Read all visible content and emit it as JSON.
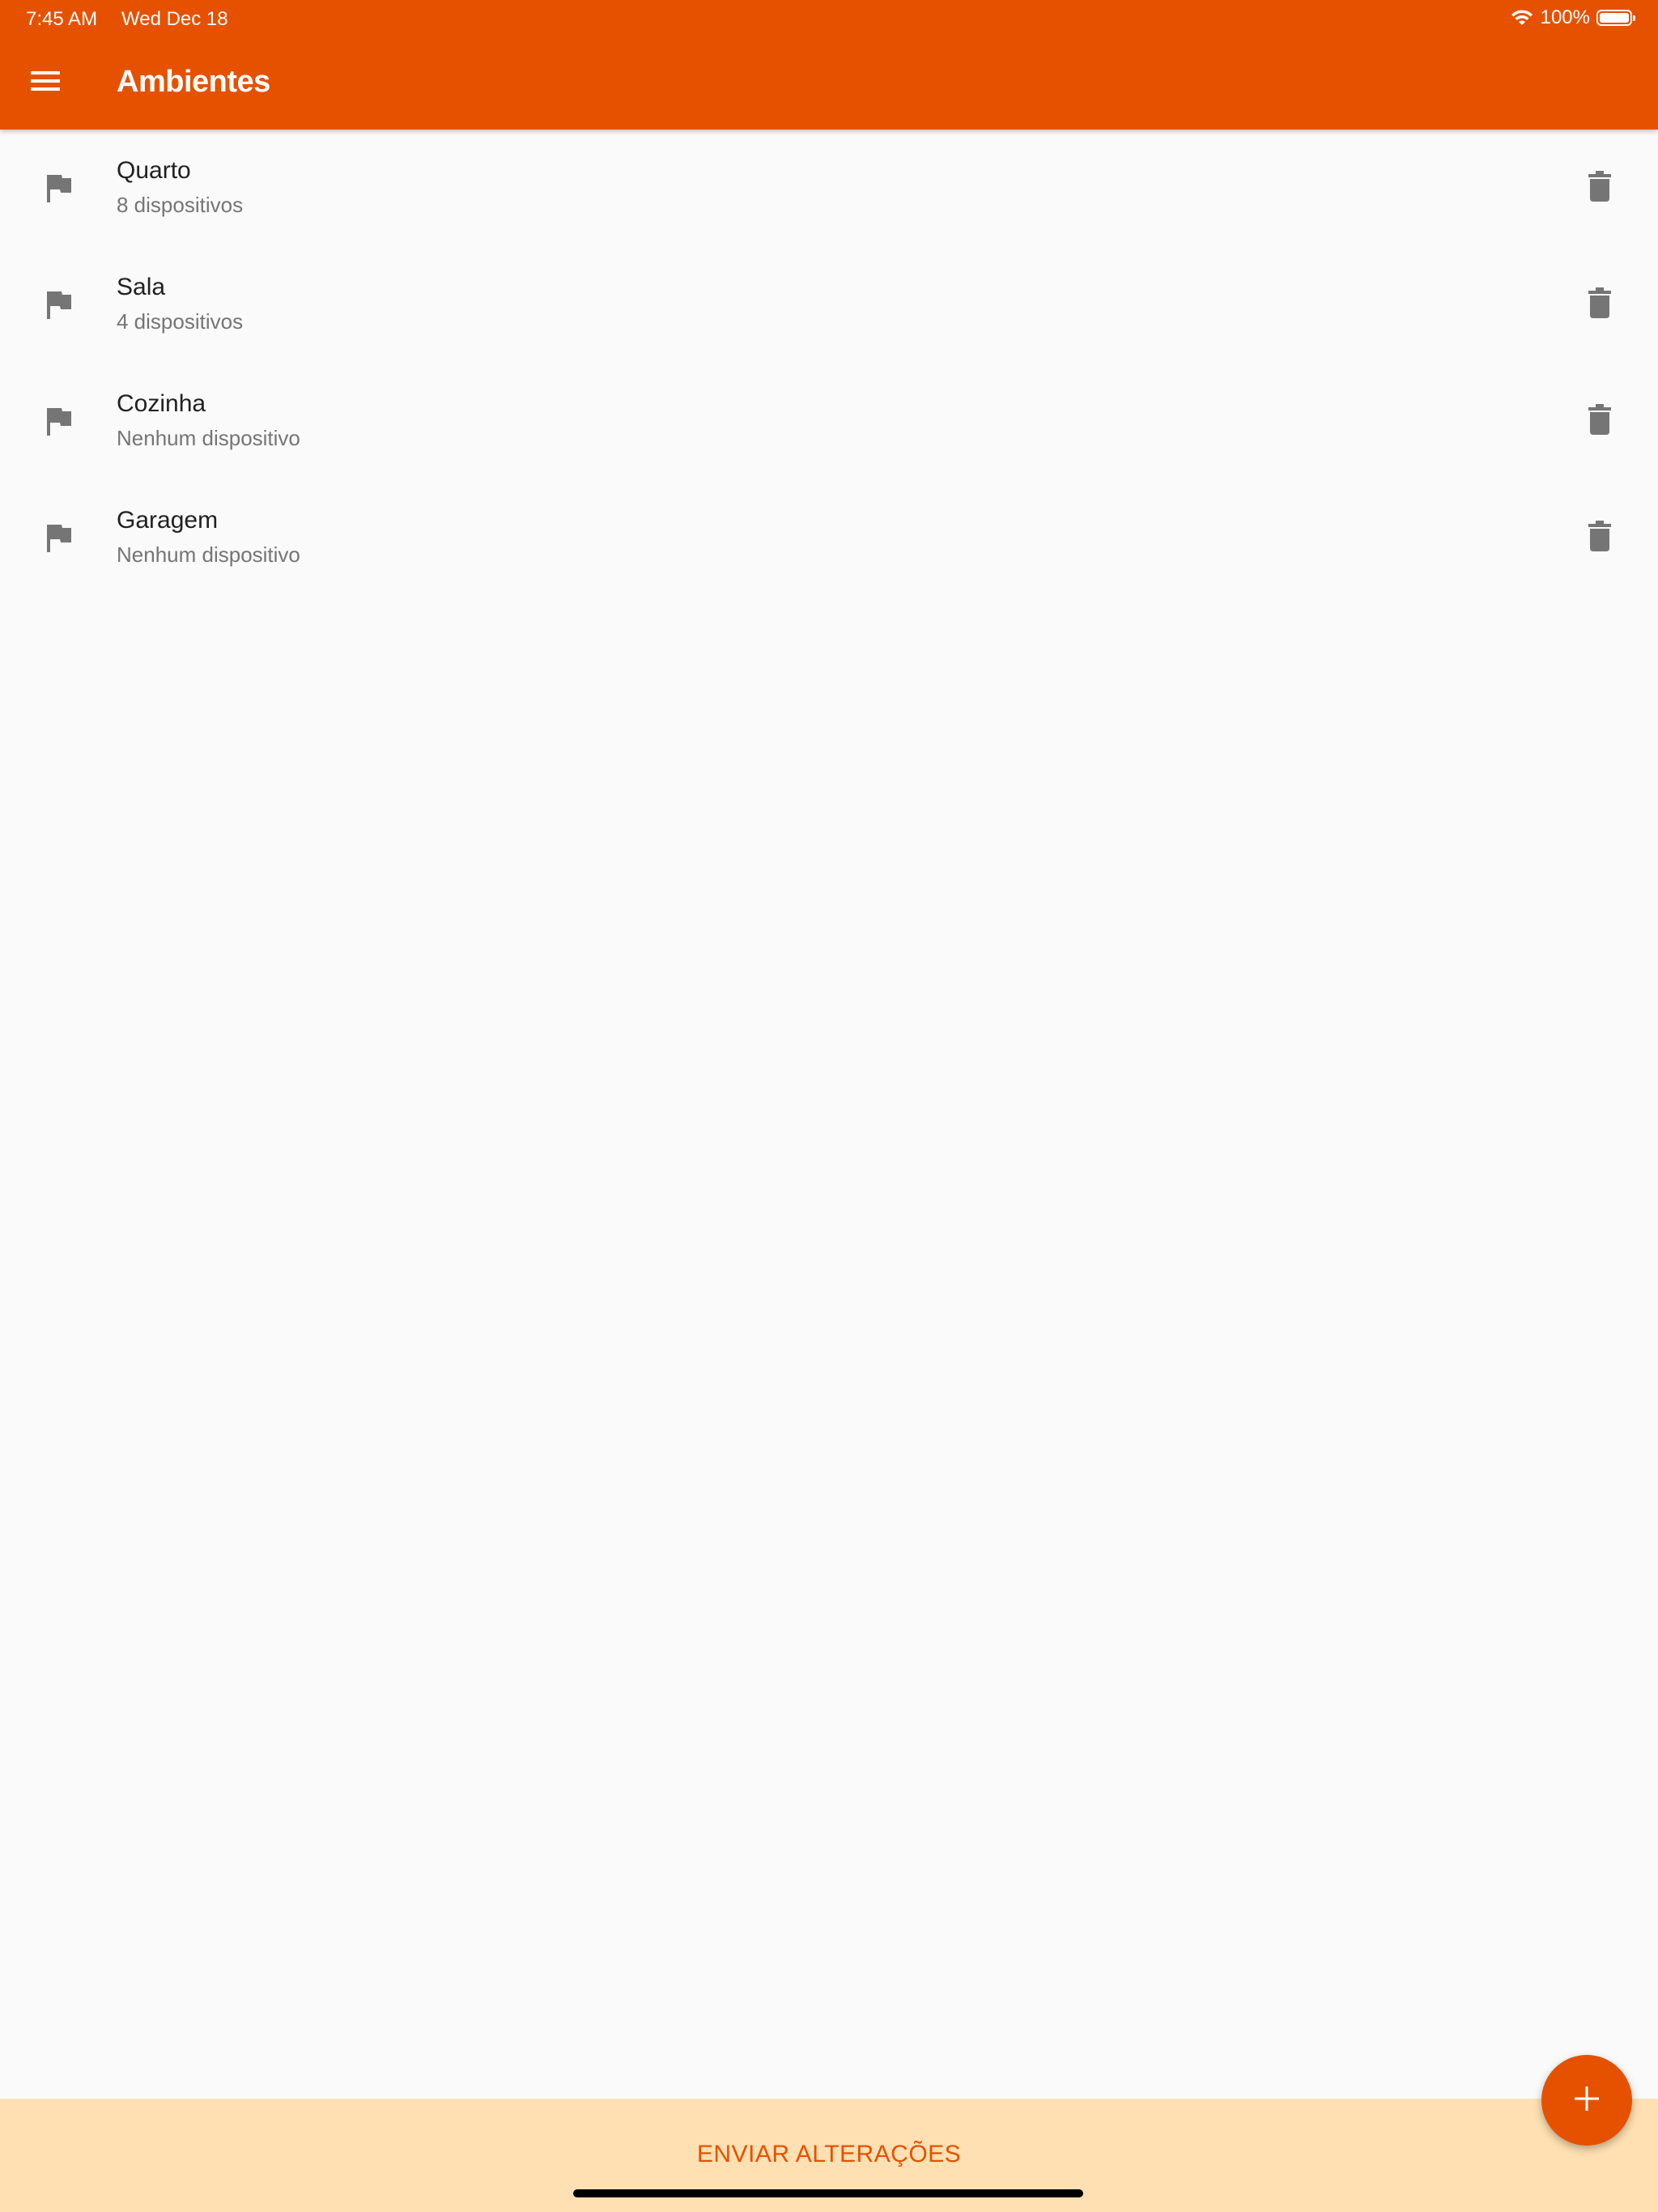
{
  "status_bar": {
    "time": "7:45 AM",
    "date": "Wed Dec 18",
    "battery_percent": "100%",
    "icons": [
      "wifi-icon",
      "battery-icon"
    ]
  },
  "header": {
    "title": "Ambientes",
    "menu_icon": "menu-icon"
  },
  "rooms": [
    {
      "name": "Quarto",
      "devices": "8 dispositivos",
      "icon": "flag-icon"
    },
    {
      "name": "Sala",
      "devices": "4 dispositivos",
      "icon": "flag-icon"
    },
    {
      "name": "Cozinha",
      "devices": "Nenhum dispositivo",
      "icon": "flag-icon"
    },
    {
      "name": "Garagem",
      "devices": "Nenhum dispositivo",
      "icon": "flag-icon"
    }
  ],
  "fab": {
    "icon": "plus-icon"
  },
  "bottom_bar": {
    "send_label": "ENVIAR ALTERAÇÕES"
  },
  "colors": {
    "primary": "#E65100",
    "bottom_bar_bg": "#FFE0B2",
    "background": "#FAFAFA",
    "icon_gray": "#757575",
    "text_primary": "#212121",
    "text_secondary": "#757575"
  }
}
